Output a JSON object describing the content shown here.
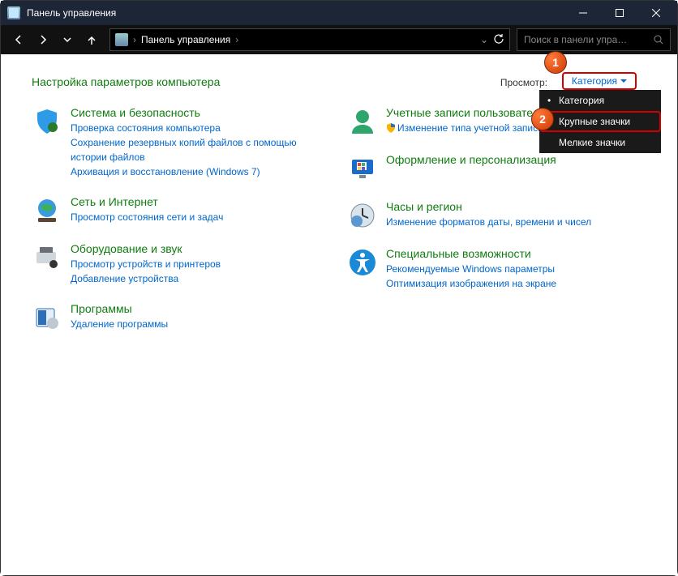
{
  "title": "Панель управления",
  "breadcrumb": {
    "root": "Панель управления"
  },
  "search": {
    "placeholder": "Поиск в панели упра…"
  },
  "heading": "Настройка параметров компьютера",
  "view": {
    "label": "Просмотр:",
    "current": "Категория",
    "options": [
      "Категория",
      "Крупные значки",
      "Мелкие значки"
    ]
  },
  "annotations": {
    "a1": "1",
    "a2": "2"
  },
  "left": [
    {
      "title": "Система и безопасность",
      "links": [
        "Проверка состояния компьютера",
        "Сохранение резервных копий файлов с помощью истории файлов",
        "Архивация и восстановление (Windows 7)"
      ]
    },
    {
      "title": "Сеть и Интернет",
      "links": [
        "Просмотр состояния сети и задач"
      ]
    },
    {
      "title": "Оборудование и звук",
      "links": [
        "Просмотр устройств и принтеров",
        "Добавление устройства"
      ]
    },
    {
      "title": "Программы",
      "links": [
        "Удаление программы"
      ]
    }
  ],
  "right": [
    {
      "title": "Учетные записи пользователей",
      "links": [
        "Изменение типа учетной записи"
      ],
      "shield": true
    },
    {
      "title": "Оформление и персонализация",
      "links": []
    },
    {
      "title": "Часы и регион",
      "links": [
        "Изменение форматов даты, времени и чисел"
      ]
    },
    {
      "title": "Специальные возможности",
      "links": [
        "Рекомендуемые Windows параметры",
        "Оптимизация изображения на экране"
      ]
    }
  ]
}
